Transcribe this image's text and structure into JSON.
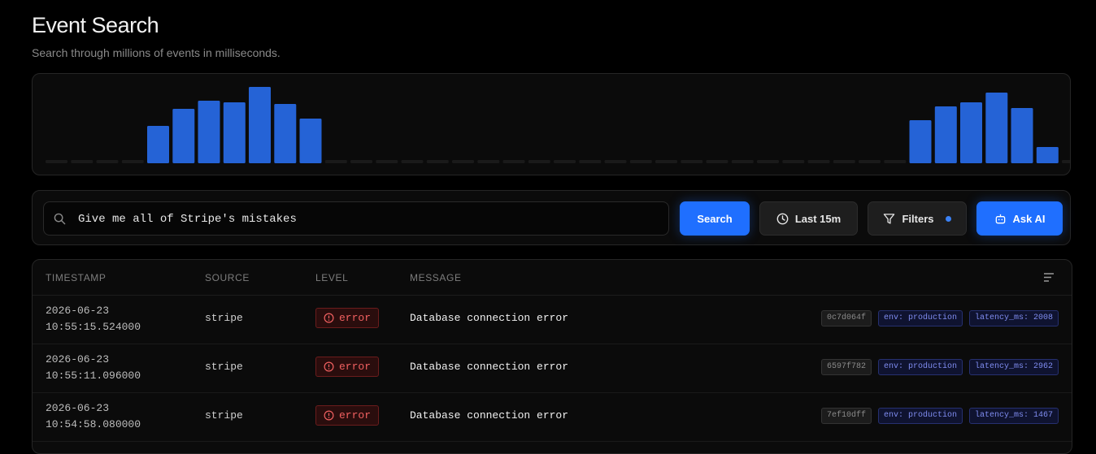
{
  "header": {
    "title": "Event Search",
    "subtitle": "Search through millions of events in milliseconds."
  },
  "histogram": {
    "bar_color": "#2563d6",
    "empty_color": "#1a1a1a",
    "values": [
      0,
      0,
      0,
      0,
      46,
      67,
      77,
      75,
      94,
      73,
      55,
      0,
      0,
      0,
      0,
      0,
      0,
      0,
      0,
      0,
      0,
      0,
      0,
      0,
      0,
      0,
      0,
      0,
      0,
      0,
      0,
      0,
      0,
      0,
      53,
      70,
      75,
      87,
      68,
      20,
      0
    ]
  },
  "search": {
    "query": "Give me all of Stripe's mistakes",
    "search_button": "Search",
    "time_button": "Last 15m",
    "filters_button": "Filters",
    "ask_ai_button": "Ask AI"
  },
  "table": {
    "columns": [
      "TIMESTAMP",
      "SOURCE",
      "LEVEL",
      "MESSAGE"
    ],
    "rows": [
      {
        "date": "2026-06-23",
        "time": "10:55:15.524000",
        "source": "stripe",
        "level": "error",
        "message": "Database connection error",
        "id": "0c7d064f",
        "env": "env: production",
        "latency": "latency_ms: 2008"
      },
      {
        "date": "2026-06-23",
        "time": "10:55:11.096000",
        "source": "stripe",
        "level": "error",
        "message": "Database connection error",
        "id": "6597f782",
        "env": "env: production",
        "latency": "latency_ms: 2962"
      },
      {
        "date": "2026-06-23",
        "time": "10:54:58.080000",
        "source": "stripe",
        "level": "error",
        "message": "Database connection error",
        "id": "7ef10dff",
        "env": "env: production",
        "latency": "latency_ms: 1467"
      }
    ]
  },
  "colors": {
    "accent": "#1f6fff",
    "error": "#f06060",
    "tag_env": "#7f8cf0"
  }
}
